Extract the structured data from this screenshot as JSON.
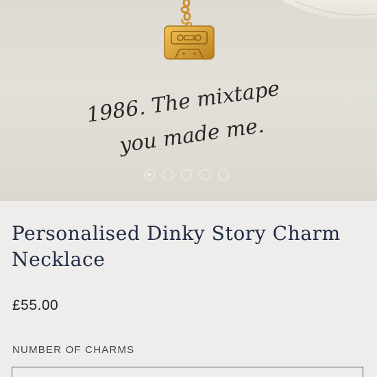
{
  "hero": {
    "caption_line1": "1986. The mixtape",
    "caption_line2": "you made me.",
    "slides_total": 5,
    "active_slide": 1
  },
  "product": {
    "title_line1": "Personalised Dinky Story Charm",
    "title_line2": "Necklace",
    "price": "£55.00",
    "charms_label": "NUMBER OF CHARMS"
  },
  "colors": {
    "title": "#1f2a44",
    "gold": "#d7a23a",
    "page_bg": "#efedeb"
  }
}
